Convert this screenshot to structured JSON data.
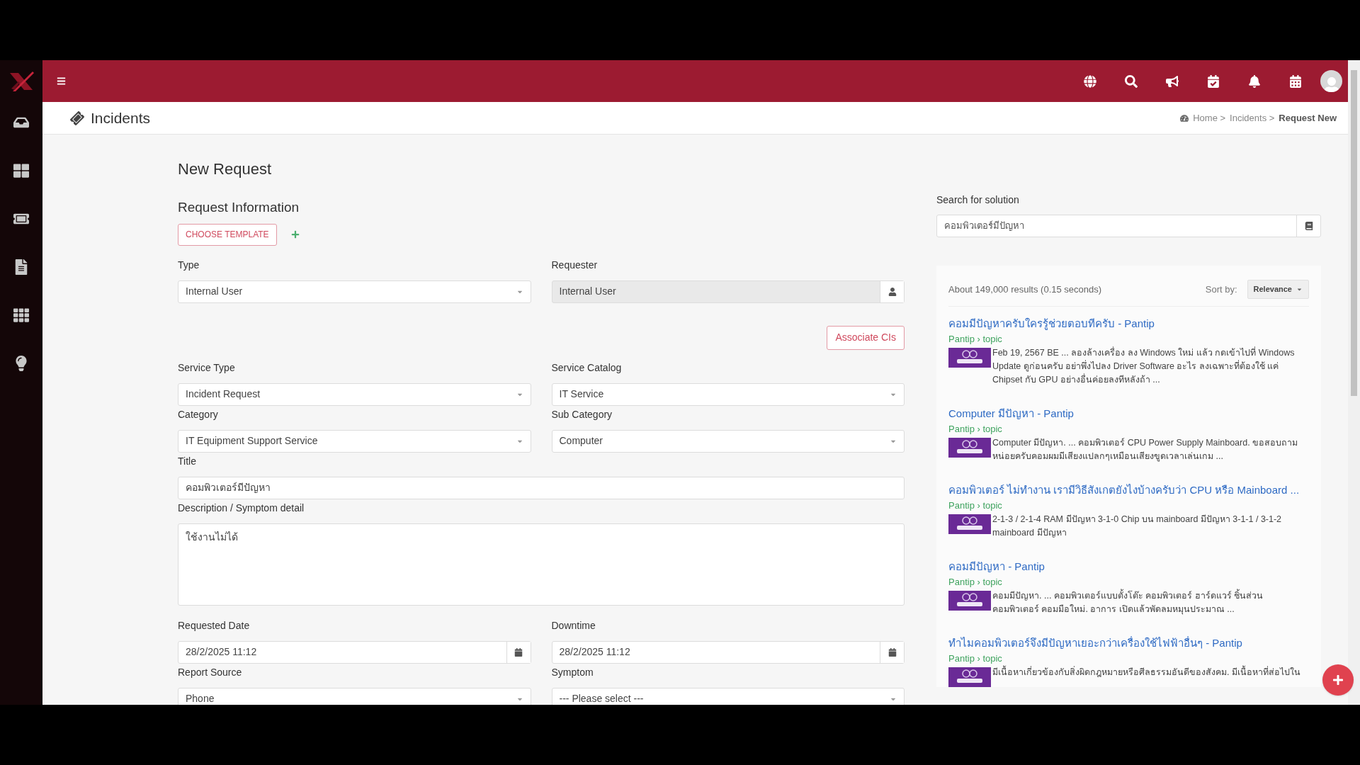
{
  "page_title": "Incidents",
  "breadcrumb": [
    {
      "label": "Home >",
      "current": false
    },
    {
      "label": "Incidents >",
      "current": false
    },
    {
      "label": "Request New",
      "current": true
    }
  ],
  "form": {
    "heading": "New Request",
    "section": "Request Information",
    "template_button": "CHOOSE TEMPLATE",
    "fields": [
      {
        "label": "Type",
        "value": "Internal User",
        "kind": "select",
        "readonly": false
      },
      {
        "label": "Requester",
        "value": "Internal User",
        "kind": "lookup",
        "readonly": true
      },
      {
        "label": "Service Type",
        "value": "Incident Request",
        "kind": "select",
        "readonly": false
      },
      {
        "label": "Service Catalog",
        "value": "IT Service",
        "kind": "select",
        "readonly": false
      },
      {
        "label": "Category",
        "value": "IT Equipment Support Service",
        "kind": "select",
        "readonly": false
      },
      {
        "label": "Sub Category",
        "value": "Computer",
        "kind": "select",
        "readonly": false
      },
      {
        "label": "Title",
        "value": "คอมพิวเตอร์มีปัญหา",
        "kind": "text",
        "readonly": false
      },
      {
        "label": "Description / Symptom detail",
        "value": "ใช้งานไม่ได้",
        "kind": "textarea",
        "readonly": false
      },
      {
        "label": "Requested Date",
        "value": "28/2/2025 11:12",
        "kind": "date",
        "readonly": false
      },
      {
        "label": "Downtime",
        "value": "28/2/2025 11:12",
        "kind": "date",
        "readonly": false
      },
      {
        "label": "Report Source",
        "value": "Phone",
        "kind": "select",
        "readonly": false
      },
      {
        "label": "Symptom",
        "value": "--- Please select ---",
        "kind": "select",
        "readonly": false
      }
    ],
    "associate_button": "Associate CIs"
  },
  "solution": {
    "label": "Search for solution",
    "query": "คอมพิวเตอร์มีปัญหา",
    "stats": "About 149,000 results (0.15 seconds)",
    "sort_label": "Sort by:",
    "sort_value": "Relevance",
    "results": [
      {
        "title": "คอมมีปัญหาครับใครรู้ช่วยตอบทีครับ - Pantip",
        "source": "Pantip › topic",
        "snippet": "Feb 19, 2567 BE ... ลองล้างเครื่อง ลง Windows ใหม่ แล้ว กดเข้าไปที่ Windows Update ดูก่อนครับ อย่าพึ่งไปลง Driver Software อะไร ลงเฉพาะที่ต้องใช้ แค่ Chipset กับ GPU อย่างอื่นค่อยลงทีหลังถ้า ..."
      },
      {
        "title": "Computer มีปัญหา - Pantip",
        "source": "Pantip › topic",
        "snippet": "Computer มีปัญหา. ... คอมพิวเตอร์ CPU Power Supply Mainboard. ขอสอบถามหน่อยครับคอมผมมีเสียงแปลกๆเหมือนเสียงขูดเวลาเล่นเกม ..."
      },
      {
        "title": "คอมพิวเตอร์ ไม่ทำงาน เรามีวิธีสังเกตยังไงบ้างครับว่า CPU หรือ Mainboard ...",
        "source": "Pantip › topic",
        "snippet": "2-1-3 / 2-1-4 RAM มีปัญหา 3-1-0 Chip บน mainboard มีปัญหา 3-1-1 / 3-1-2 mainboard มีปัญหา"
      },
      {
        "title": "คอมมีปัญหา - Pantip",
        "source": "Pantip › topic",
        "snippet": "คอมมีปัญหา. ... คอมพิวเตอร์แบบตั้งโต๊ะ คอมพิวเตอร์ ฮาร์ดแวร์ ชิ้นส่วนคอมพิวเตอร์ คอมมือใหม่. อาการ เปิดแล้วพัดลมหมุนประมาณ ..."
      },
      {
        "title": "ทำไมคอมพิวเตอร์จึงมีปัญหาเยอะกว่าเครื่องใช้ไฟฟ้าอื่นๆ - Pantip",
        "source": "Pantip › topic",
        "snippet": "มีเนื้อหาเกี่ยวข้องกับสิ่งผิดกฎหมายหรือศีลธรรมอันดีของสังคม. มีเนื้อหาที่ส่อไปใน"
      }
    ]
  }
}
